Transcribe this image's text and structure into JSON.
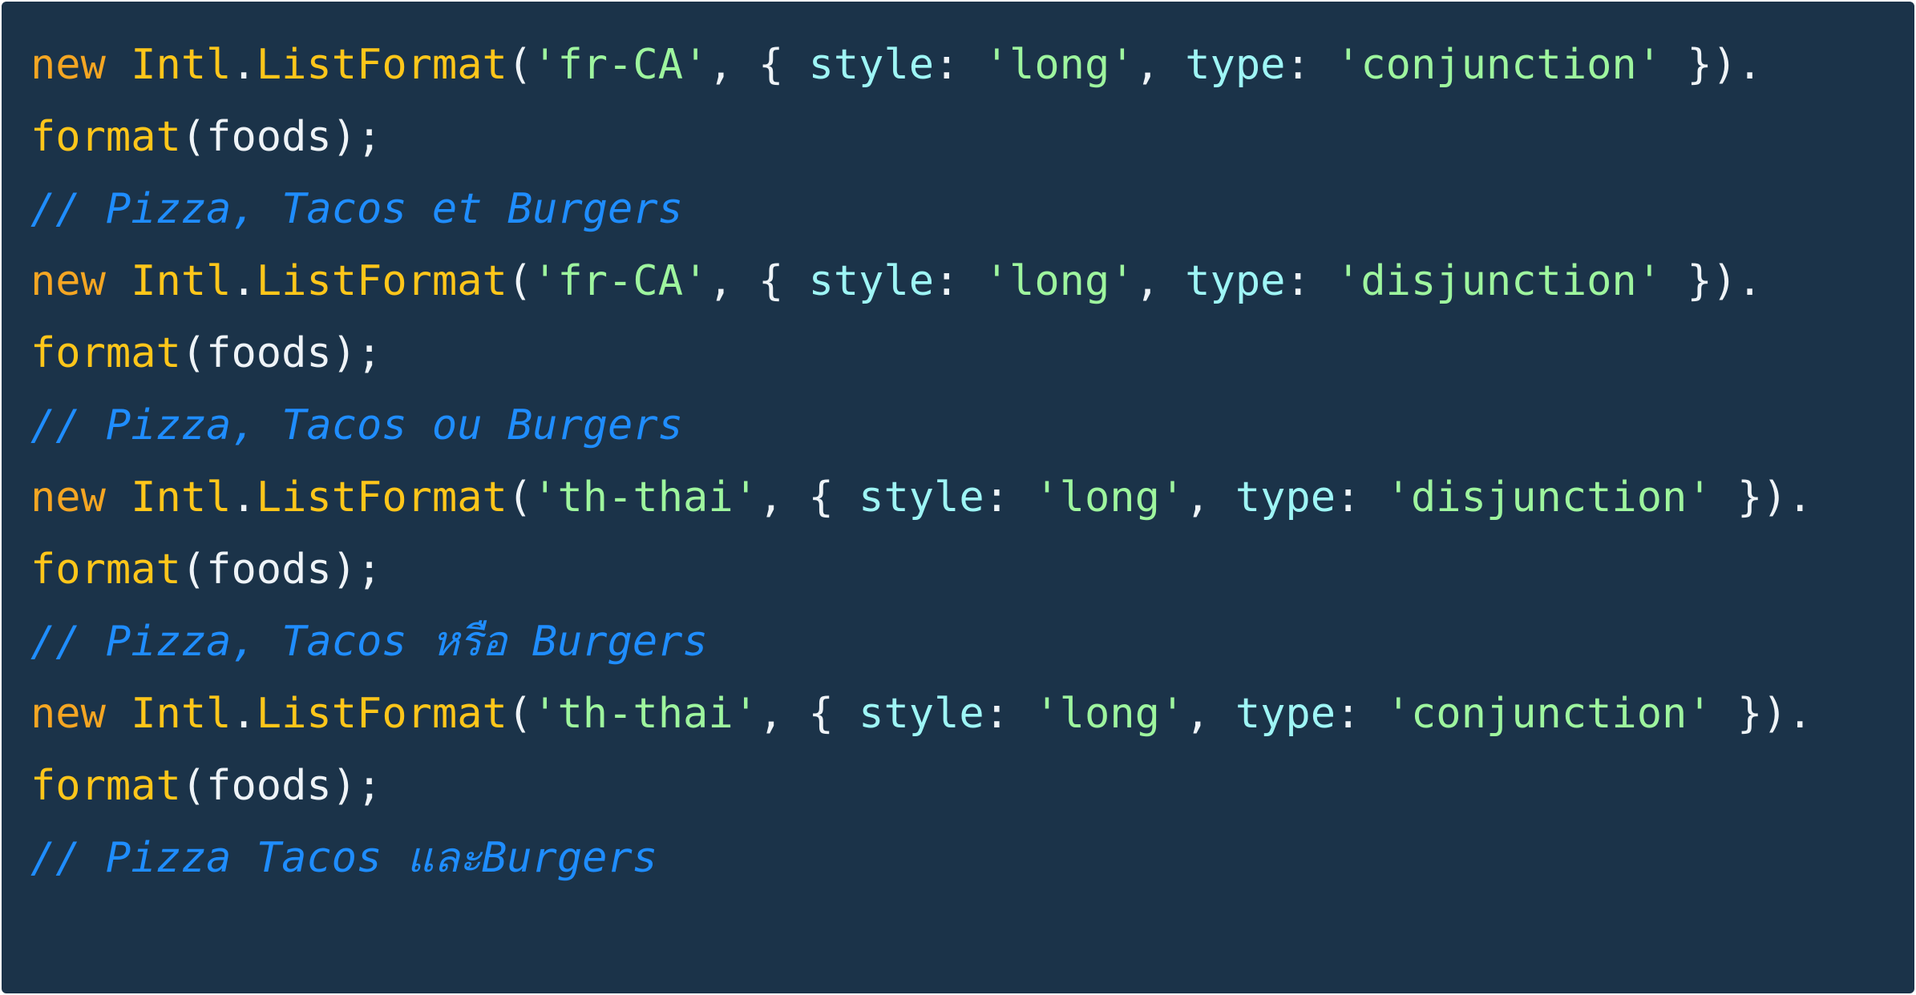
{
  "theme": {
    "background": "#1b3349",
    "keyword": "#f5a623",
    "identifier": "#ffc61a",
    "string": "#9ef59e",
    "property": "#9ef5f5",
    "plain": "#eef3f7",
    "comment": "#1f8dff"
  },
  "code": {
    "lines": [
      {
        "kind": "statement",
        "tokens": [
          {
            "t": "new",
            "c": "kw"
          },
          {
            "t": " ",
            "c": "punc"
          },
          {
            "t": "Intl",
            "c": "class"
          },
          {
            "t": ".",
            "c": "punc"
          },
          {
            "t": "ListFormat",
            "c": "fn"
          },
          {
            "t": "(",
            "c": "punc"
          },
          {
            "t": "'fr-CA'",
            "c": "str"
          },
          {
            "t": ", { ",
            "c": "punc"
          },
          {
            "t": "style",
            "c": "prop"
          },
          {
            "t": ": ",
            "c": "punc"
          },
          {
            "t": "'long'",
            "c": "str"
          },
          {
            "t": ", ",
            "c": "punc"
          },
          {
            "t": "type",
            "c": "prop"
          },
          {
            "t": ": ",
            "c": "punc"
          },
          {
            "t": "'conjunction'",
            "c": "str"
          },
          {
            "t": " }).",
            "c": "punc"
          }
        ]
      },
      {
        "kind": "statement",
        "tokens": [
          {
            "t": "format",
            "c": "fn"
          },
          {
            "t": "(",
            "c": "punc"
          },
          {
            "t": "foods",
            "c": "var"
          },
          {
            "t": ");",
            "c": "punc"
          }
        ]
      },
      {
        "kind": "comment",
        "tokens": [
          {
            "t": "// Pizza, Tacos et Burgers",
            "c": "comment"
          }
        ]
      },
      {
        "kind": "statement",
        "tokens": [
          {
            "t": "new",
            "c": "kw"
          },
          {
            "t": " ",
            "c": "punc"
          },
          {
            "t": "Intl",
            "c": "class"
          },
          {
            "t": ".",
            "c": "punc"
          },
          {
            "t": "ListFormat",
            "c": "fn"
          },
          {
            "t": "(",
            "c": "punc"
          },
          {
            "t": "'fr-CA'",
            "c": "str"
          },
          {
            "t": ", { ",
            "c": "punc"
          },
          {
            "t": "style",
            "c": "prop"
          },
          {
            "t": ": ",
            "c": "punc"
          },
          {
            "t": "'long'",
            "c": "str"
          },
          {
            "t": ", ",
            "c": "punc"
          },
          {
            "t": "type",
            "c": "prop"
          },
          {
            "t": ": ",
            "c": "punc"
          },
          {
            "t": "'disjunction'",
            "c": "str"
          },
          {
            "t": " }).",
            "c": "punc"
          }
        ]
      },
      {
        "kind": "statement",
        "tokens": [
          {
            "t": "format",
            "c": "fn"
          },
          {
            "t": "(",
            "c": "punc"
          },
          {
            "t": "foods",
            "c": "var"
          },
          {
            "t": ");",
            "c": "punc"
          }
        ]
      },
      {
        "kind": "comment",
        "tokens": [
          {
            "t": "// Pizza, Tacos ou Burgers",
            "c": "comment"
          }
        ]
      },
      {
        "kind": "statement",
        "tokens": [
          {
            "t": "new",
            "c": "kw"
          },
          {
            "t": " ",
            "c": "punc"
          },
          {
            "t": "Intl",
            "c": "class"
          },
          {
            "t": ".",
            "c": "punc"
          },
          {
            "t": "ListFormat",
            "c": "fn"
          },
          {
            "t": "(",
            "c": "punc"
          },
          {
            "t": "'th-thai'",
            "c": "str"
          },
          {
            "t": ", { ",
            "c": "punc"
          },
          {
            "t": "style",
            "c": "prop"
          },
          {
            "t": ": ",
            "c": "punc"
          },
          {
            "t": "'long'",
            "c": "str"
          },
          {
            "t": ", ",
            "c": "punc"
          },
          {
            "t": "type",
            "c": "prop"
          },
          {
            "t": ": ",
            "c": "punc"
          },
          {
            "t": "'disjunction'",
            "c": "str"
          },
          {
            "t": " }).",
            "c": "punc"
          }
        ]
      },
      {
        "kind": "statement",
        "tokens": [
          {
            "t": "format",
            "c": "fn"
          },
          {
            "t": "(",
            "c": "punc"
          },
          {
            "t": "foods",
            "c": "var"
          },
          {
            "t": ");",
            "c": "punc"
          }
        ]
      },
      {
        "kind": "comment",
        "tokens": [
          {
            "t": "// Pizza, Tacos หรือ Burgers",
            "c": "comment"
          }
        ]
      },
      {
        "kind": "statement",
        "tokens": [
          {
            "t": "new",
            "c": "kw"
          },
          {
            "t": " ",
            "c": "punc"
          },
          {
            "t": "Intl",
            "c": "class"
          },
          {
            "t": ".",
            "c": "punc"
          },
          {
            "t": "ListFormat",
            "c": "fn"
          },
          {
            "t": "(",
            "c": "punc"
          },
          {
            "t": "'th-thai'",
            "c": "str"
          },
          {
            "t": ", { ",
            "c": "punc"
          },
          {
            "t": "style",
            "c": "prop"
          },
          {
            "t": ": ",
            "c": "punc"
          },
          {
            "t": "'long'",
            "c": "str"
          },
          {
            "t": ", ",
            "c": "punc"
          },
          {
            "t": "type",
            "c": "prop"
          },
          {
            "t": ": ",
            "c": "punc"
          },
          {
            "t": "'conjunction'",
            "c": "str"
          },
          {
            "t": " }).",
            "c": "punc"
          }
        ]
      },
      {
        "kind": "statement",
        "tokens": [
          {
            "t": "format",
            "c": "fn"
          },
          {
            "t": "(",
            "c": "punc"
          },
          {
            "t": "foods",
            "c": "var"
          },
          {
            "t": ");",
            "c": "punc"
          }
        ]
      },
      {
        "kind": "comment",
        "tokens": [
          {
            "t": "// Pizza Tacos และBurgers",
            "c": "comment"
          }
        ]
      }
    ]
  }
}
